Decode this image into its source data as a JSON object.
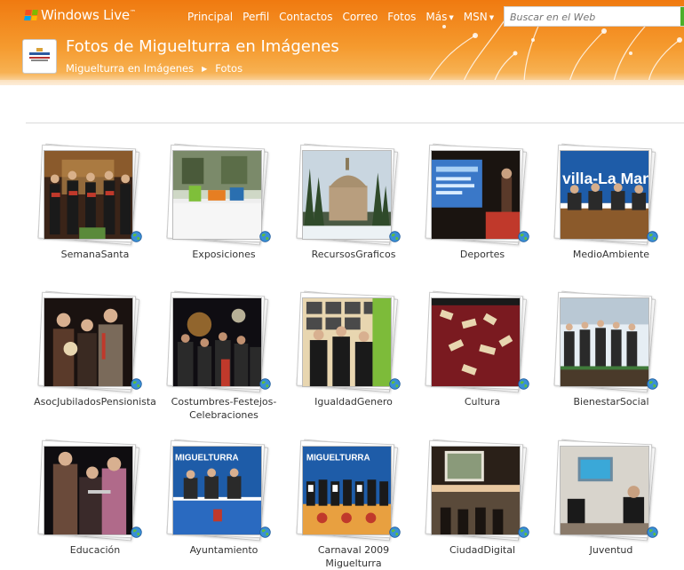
{
  "brand": {
    "name": "Windows Live",
    "tm": "™",
    "flag_colors": [
      "#f25022",
      "#7fba00",
      "#00a4ef",
      "#ffb900"
    ]
  },
  "topnav": [
    {
      "label": "Principal",
      "has_caret": false
    },
    {
      "label": "Perfil",
      "has_caret": false
    },
    {
      "label": "Contactos",
      "has_caret": false
    },
    {
      "label": "Correo",
      "has_caret": false
    },
    {
      "label": "Fotos",
      "has_caret": false
    },
    {
      "label": "Más",
      "has_caret": true
    },
    {
      "label": "MSN",
      "has_caret": true
    }
  ],
  "search": {
    "placeholder": "Buscar en el Web",
    "button_color": "#4caf2a"
  },
  "page": {
    "title": "Fotos de Miguelturra en Imágenes"
  },
  "breadcrumb": {
    "space": "Miguelturra en Imágenes",
    "current": "Fotos"
  },
  "albums": [
    {
      "label": "SemanaSanta",
      "theme": "choir"
    },
    {
      "label": "Exposiciones",
      "theme": "exhibit"
    },
    {
      "label": "RecursosGraficos",
      "theme": "church"
    },
    {
      "label": "Deportes",
      "theme": "presentation"
    },
    {
      "label": "MedioAmbiente",
      "theme": "panel"
    },
    {
      "label": "AsocJubiladosPensionista",
      "theme": "people"
    },
    {
      "label": "Costumbres-Festejos-Celebraciones",
      "theme": "night"
    },
    {
      "label": "IgualdadGenero",
      "theme": "gallery"
    },
    {
      "label": "Cultura",
      "theme": "crafts"
    },
    {
      "label": "BienestarSocial",
      "theme": "outdoor"
    },
    {
      "label": "Educación",
      "theme": "stage"
    },
    {
      "label": "Ayuntamiento",
      "theme": "council"
    },
    {
      "label": "Carnaval 2009 Miguelturra",
      "theme": "carnaval"
    },
    {
      "label": "CiudadDigital",
      "theme": "auditorium"
    },
    {
      "label": "Juventud",
      "theme": "classroom"
    }
  ]
}
